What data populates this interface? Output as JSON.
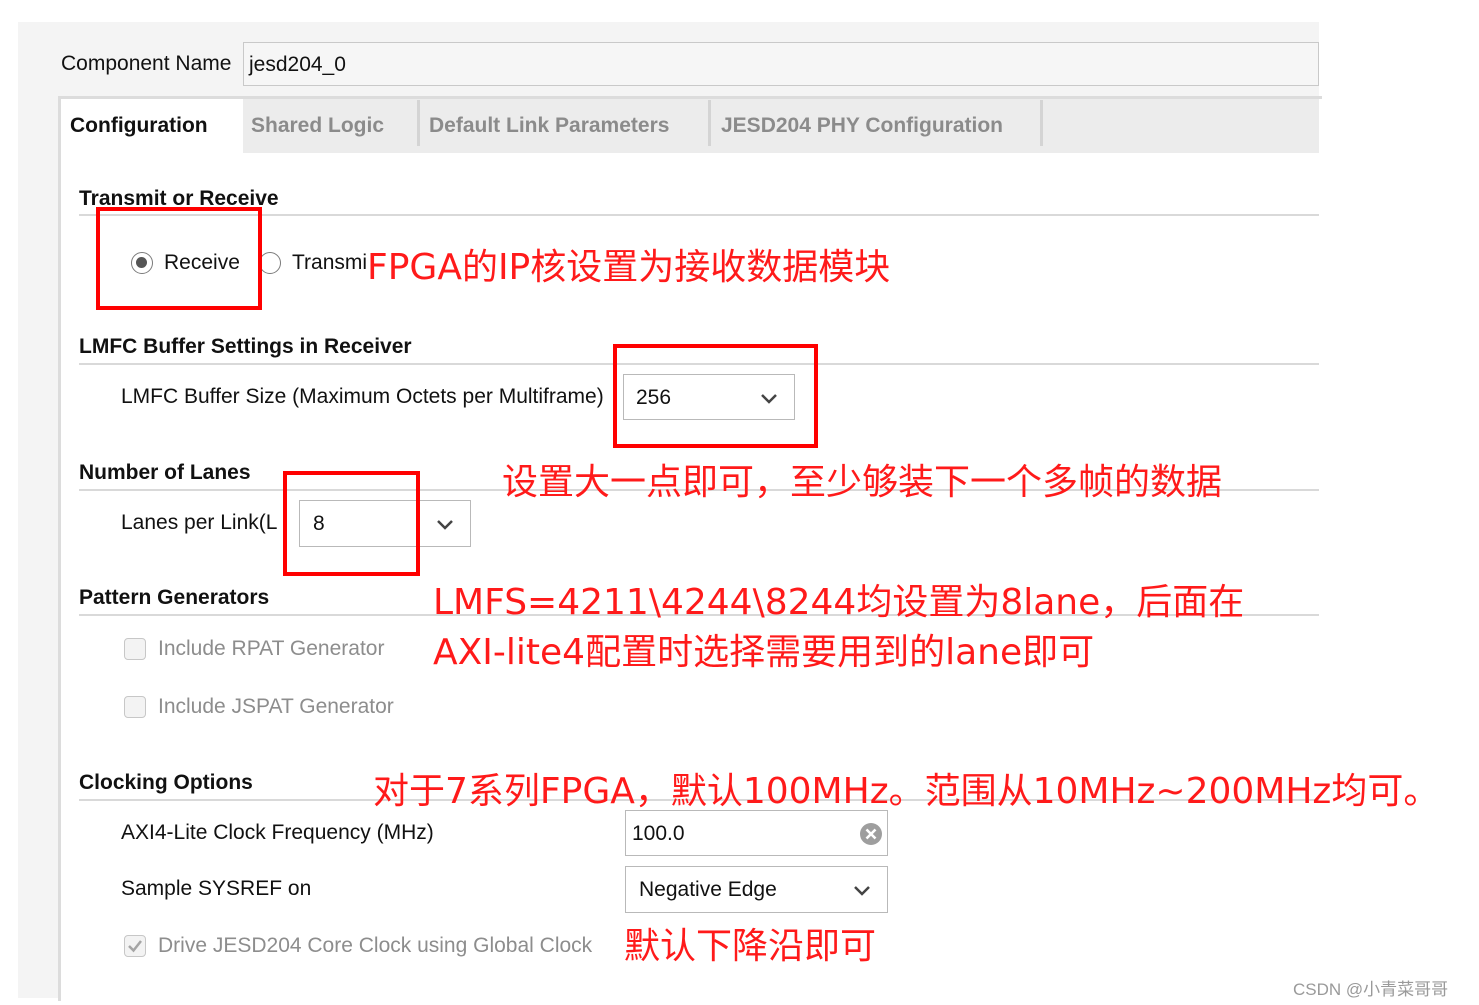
{
  "component_name": {
    "label": "Component Name",
    "value": "jesd204_0"
  },
  "tabs": [
    "Configuration",
    "Shared Logic",
    "Default Link Parameters",
    "JESD204 PHY Configuration"
  ],
  "sections": {
    "transmit_receive": {
      "title": "Transmit or Receive",
      "receive_label": "Receive",
      "transmit_label": "Transmi",
      "selected": "Receive"
    },
    "lmfc": {
      "title": "LMFC Buffer Settings in Receiver",
      "buffer_label": "LMFC Buffer Size (Maximum Octets per Multiframe)",
      "buffer_value": "256"
    },
    "lanes": {
      "title": "Number of Lanes",
      "lanes_label": "Lanes per Link(L",
      "lanes_value": "8"
    },
    "patterns": {
      "title": "Pattern Generators",
      "rpat_label": "Include RPAT Generator",
      "jspat_label": "Include JSPAT Generator"
    },
    "clocking": {
      "title": "Clocking Options",
      "axi_label": "AXI4-Lite Clock Frequency (MHz)",
      "axi_value": "100.0",
      "sysref_label": "Sample SYSREF on",
      "sysref_value": "Negative Edge",
      "global_clock_label": "Drive JESD204 Core Clock using Global Clock"
    }
  },
  "annotations": {
    "receive_note": "FPGA的IP核设置为接收数据模块",
    "buffer_note": "设置大一点即可，至少够装下一个多帧的数据",
    "lanes_note_1": "LMFS=4211\\4244\\8244均设置为8lane，后面在",
    "lanes_note_2": "AXI-lite4配置时选择需要用到的lane即可",
    "clock_note": "对于7系列FPGA，默认100MHz。范围从10MHz~200MHz均可。",
    "sysref_note": "默认下降沿即可"
  },
  "watermark": "CSDN @小青菜哥哥",
  "colors": {
    "annotation": "#ff0000",
    "tab_active_bg": "#ffffff",
    "tab_strip_bg": "#ececec"
  }
}
